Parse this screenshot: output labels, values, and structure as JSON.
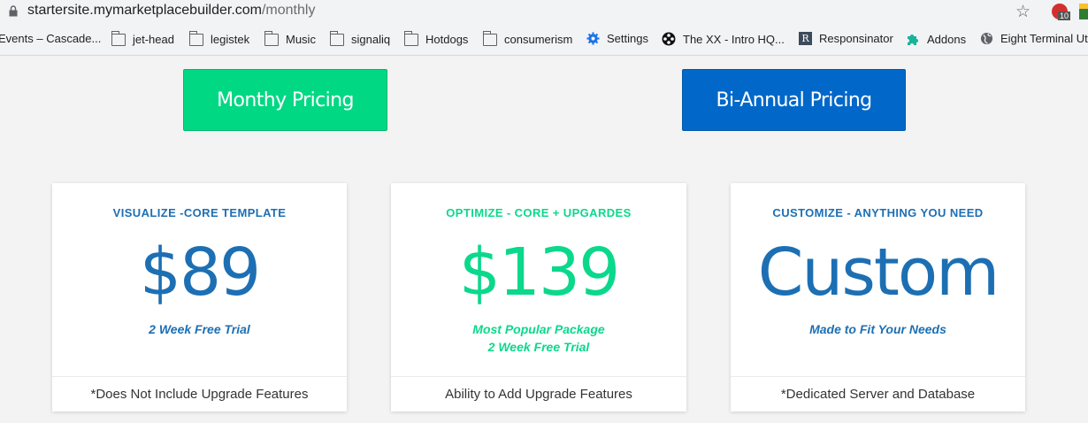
{
  "browser": {
    "url_host": "startersite.mymarketplacebuilder.com",
    "url_path": "/monthly",
    "abp_count": "10",
    "bookmarks": [
      {
        "label": "Events – Cascade...",
        "icon": "none"
      },
      {
        "label": "jet-head",
        "icon": "folder-icon"
      },
      {
        "label": "legistek",
        "icon": "folder-icon"
      },
      {
        "label": "Music",
        "icon": "folder-icon"
      },
      {
        "label": "signaliq",
        "icon": "folder-icon"
      },
      {
        "label": "Hotdogs",
        "icon": "folder-icon"
      },
      {
        "label": "consumerism",
        "icon": "folder-icon"
      },
      {
        "label": "Settings",
        "icon": "gear-icon"
      },
      {
        "label": "The XX - Intro HQ...",
        "icon": "film-reel-icon"
      },
      {
        "label": "Responsinator",
        "icon": "r-icon"
      },
      {
        "label": "Addons",
        "icon": "puzzle-icon"
      },
      {
        "label": "Eight Terminal Uti",
        "icon": "globe-icon"
      }
    ]
  },
  "pricing_toggle": {
    "monthly_label": "Monthy Pricing",
    "biannual_label": "Bi-Annual Pricing"
  },
  "plans": [
    {
      "category": "VISUALIZE -CORE TEMPLATE",
      "price": "$89",
      "note_line1": "2 Week Free Trial",
      "note_line2": "",
      "footer": "*Does Not Include Upgrade Features"
    },
    {
      "category": "OPTIMIZE - CORE + UPGARDES",
      "price": "$139",
      "note_line1": "Most Popular Package",
      "note_line2": "2 Week Free Trial",
      "footer": "Ability to Add Upgrade Features"
    },
    {
      "category": "CUSTOMIZE - ANYTHING YOU NEED",
      "price": "Custom",
      "note_line1": "Made to Fit Your Needs",
      "note_line2": "",
      "footer": "*Dedicated Server and Database"
    }
  ],
  "colors": {
    "brand_blue": "#1d6fb3",
    "brand_green": "#0bd88b",
    "monthly_button": "#01d884",
    "biannual_button": "#0168c9"
  }
}
